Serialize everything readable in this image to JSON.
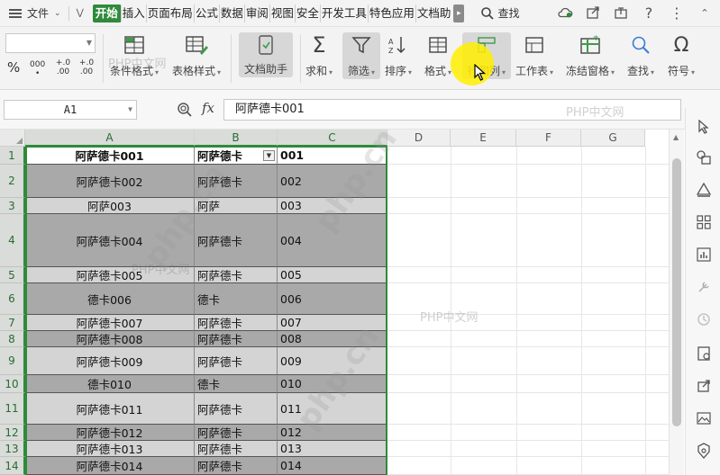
{
  "menubar": {
    "file_label": "文件",
    "tabs": [
      {
        "label": "开始",
        "active": true
      },
      {
        "label": "插入"
      },
      {
        "label": "页面布局"
      },
      {
        "label": "公式"
      },
      {
        "label": "数据"
      },
      {
        "label": "审阅"
      },
      {
        "label": "视图"
      },
      {
        "label": "安全"
      },
      {
        "label": "开发工具"
      },
      {
        "label": "特色应用"
      },
      {
        "label": "文档助"
      }
    ],
    "search_label": "查找",
    "accent_color": "#2f8a3b"
  },
  "ribbon": {
    "number_format": {
      "percent": "%",
      "thousands": "000",
      "inc_decimal": "+.0 .00",
      "dec_decimal": "+.0 .00"
    },
    "buttons": [
      {
        "label": "条件格式",
        "icon": "conditional-format-icon"
      },
      {
        "label": "表格样式",
        "icon": "table-style-icon"
      },
      {
        "label": "文档助手",
        "icon": "doc-assistant-icon"
      },
      {
        "label": "求和",
        "icon": "sum-icon"
      },
      {
        "label": "筛选",
        "icon": "filter-icon"
      },
      {
        "label": "排序",
        "icon": "sort-icon"
      },
      {
        "label": "格式",
        "icon": "format-icon"
      },
      {
        "label": "行和列",
        "icon": "row-col-icon"
      },
      {
        "label": "工作表",
        "icon": "worksheet-icon"
      },
      {
        "label": "冻结窗格",
        "icon": "freeze-icon"
      },
      {
        "label": "查找",
        "icon": "find-icon"
      },
      {
        "label": "符号",
        "icon": "symbol-icon"
      }
    ]
  },
  "formula_bar": {
    "name_box": "A1",
    "fx_label": "fx",
    "formula": "阿萨德卡001"
  },
  "columns": [
    "A",
    "B",
    "C",
    "D",
    "E",
    "F",
    "G"
  ],
  "rows": [
    {
      "num": "1",
      "a": "阿萨德卡001",
      "b": "阿萨德卡",
      "c": "001"
    },
    {
      "num": "2",
      "a": "阿萨德卡002",
      "b": "阿萨德卡",
      "c": "002"
    },
    {
      "num": "3",
      "a": "阿萨003",
      "b": "阿萨",
      "c": "003"
    },
    {
      "num": "4",
      "a": "阿萨德卡004",
      "b": "阿萨德卡",
      "c": "004"
    },
    {
      "num": "5",
      "a": "阿萨德卡005",
      "b": "阿萨德卡",
      "c": "005"
    },
    {
      "num": "6",
      "a": "德卡006",
      "b": "德卡",
      "c": "006"
    },
    {
      "num": "7",
      "a": "阿萨德卡007",
      "b": "阿萨德卡",
      "c": "007"
    },
    {
      "num": "8",
      "a": "阿萨德卡008",
      "b": "阿萨德卡",
      "c": "008"
    },
    {
      "num": "9",
      "a": "阿萨德卡009",
      "b": "阿萨德卡",
      "c": "009"
    },
    {
      "num": "10",
      "a": "德卡010",
      "b": "德卡",
      "c": "010"
    },
    {
      "num": "11",
      "a": "阿萨德卡011",
      "b": "阿萨德卡",
      "c": "011"
    },
    {
      "num": "12",
      "a": "阿萨德卡012",
      "b": "阿萨德卡",
      "c": "012"
    },
    {
      "num": "13",
      "a": "阿萨德卡013",
      "b": "阿萨德卡",
      "c": "013"
    },
    {
      "num": "14",
      "a": "阿萨德卡014",
      "b": "阿萨德卡",
      "c": "014"
    }
  ],
  "watermarks": {
    "text": "PHP中文网",
    "diag": "php.cn"
  },
  "colors": {
    "selection_green": "#2f8a3b",
    "row_fill_dark": "#a9a9a9",
    "row_fill_light": "#d4d4d4"
  }
}
